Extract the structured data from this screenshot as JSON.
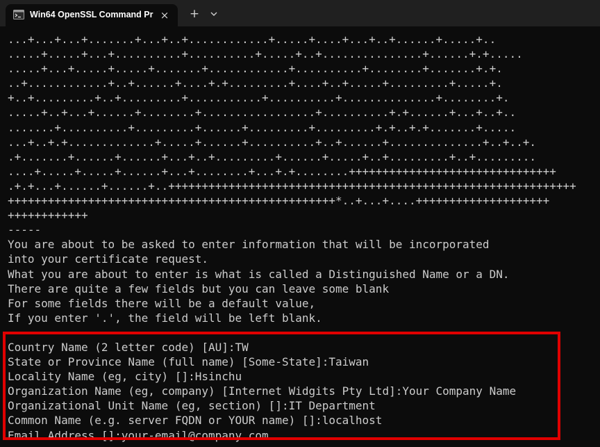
{
  "tab": {
    "title": "Win64 OpenSSL Command Pr",
    "close_glyph": "×",
    "icon": "terminal-icon"
  },
  "tabbar": {
    "new_tab_glyph": "+",
    "dropdown_icon": "chevron-down-icon"
  },
  "colors": {
    "background": "#0c0c0c",
    "text": "#cccccc",
    "highlight": "#e00000",
    "tabbar": "#202020"
  },
  "terminal": {
    "keygen_lines": [
      "...+...+...+.......+...+..+............+.....+....+...+..+......+.....+..",
      ".....+.....+...+..........+..........+.....+..+...............+......+.+.....",
      ".....+...+.....+.....+.......+............+..........+........+.......+.+.",
      "..+............+..+......+....+.+.........+....+..+.....+.........+.....+.",
      "+..+.........+..+.........+...........+..........+..............+........+.",
      ".....+..+...+......+........+.................+..........+.+......+...+..+..",
      ".......+..........+.........+......+.........+.........+.+..+.+.......+.....",
      "...+..+.+.............+.....+......+..........+..+......+..............+..+..+.",
      ".+.......+......+......+...+..+.........+......+.....+..+.........+..+.........",
      "....+.....+.....+......+...+........+...+.+........+++++++++++++++++++++++++++++++",
      ".+.+...+......+......+..+++++++++++++++++++++++++++++++++++++++++++++++++++++++++++++",
      "+++++++++++++++++++++++++++++++++++++++++++++++++*..+...+....++++++++++++++++++++",
      "++++++++++++",
      "-----"
    ],
    "info_lines": [
      "You are about to be asked to enter information that will be incorporated",
      "into your certificate request.",
      "What you are about to enter is what is called a Distinguished Name or a DN.",
      "There are quite a few fields but you can leave some blank",
      "For some fields there will be a default value,",
      "If you enter '.', the field will be left blank."
    ],
    "blank_line": "",
    "dn_fields": [
      "Country Name (2 letter code) [AU]:TW",
      "State or Province Name (full name) [Some-State]:Taiwan",
      "Locality Name (eg, city) []:Hsinchu",
      "Organization Name (eg, company) [Internet Widgits Pty Ltd]:Your Company Name",
      "Organizational Unit Name (eg, section) []:IT Department",
      "Common Name (e.g. server FQDN or YOUR name) []:localhost",
      "Email Address []:your-email@company.com"
    ]
  }
}
